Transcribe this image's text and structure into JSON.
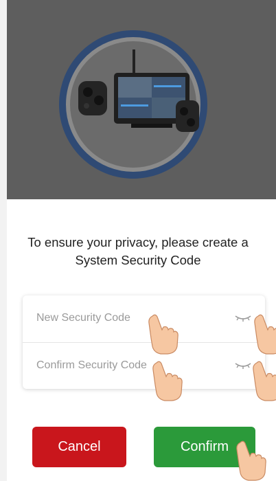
{
  "prompt": {
    "line1": "To ensure your privacy, please create a",
    "line2": "System Security Code"
  },
  "fields": {
    "new_code_placeholder": "New Security Code",
    "confirm_code_placeholder": "Confirm Security Code",
    "toggle_icon": "eye-closed-icon"
  },
  "buttons": {
    "cancel_label": "Cancel",
    "confirm_label": "Confirm",
    "cancel_color": "#c9161c",
    "confirm_color": "#2b9a3a"
  },
  "hero": {
    "ring_color": "#2f4a74",
    "image": "camera-system-product-image"
  },
  "hints": {
    "icon": "tap-hand-icon"
  }
}
